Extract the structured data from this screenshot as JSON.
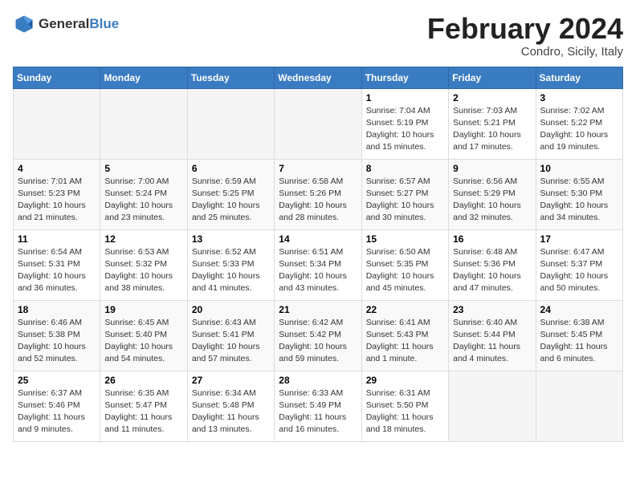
{
  "header": {
    "logo_general": "General",
    "logo_blue": "Blue",
    "month_title": "February 2024",
    "location": "Condro, Sicily, Italy"
  },
  "weekdays": [
    "Sunday",
    "Monday",
    "Tuesday",
    "Wednesday",
    "Thursday",
    "Friday",
    "Saturday"
  ],
  "weeks": [
    [
      {
        "day": "",
        "info": ""
      },
      {
        "day": "",
        "info": ""
      },
      {
        "day": "",
        "info": ""
      },
      {
        "day": "",
        "info": ""
      },
      {
        "day": "1",
        "info": "Sunrise: 7:04 AM\nSunset: 5:19 PM\nDaylight: 10 hours\nand 15 minutes."
      },
      {
        "day": "2",
        "info": "Sunrise: 7:03 AM\nSunset: 5:21 PM\nDaylight: 10 hours\nand 17 minutes."
      },
      {
        "day": "3",
        "info": "Sunrise: 7:02 AM\nSunset: 5:22 PM\nDaylight: 10 hours\nand 19 minutes."
      }
    ],
    [
      {
        "day": "4",
        "info": "Sunrise: 7:01 AM\nSunset: 5:23 PM\nDaylight: 10 hours\nand 21 minutes."
      },
      {
        "day": "5",
        "info": "Sunrise: 7:00 AM\nSunset: 5:24 PM\nDaylight: 10 hours\nand 23 minutes."
      },
      {
        "day": "6",
        "info": "Sunrise: 6:59 AM\nSunset: 5:25 PM\nDaylight: 10 hours\nand 25 minutes."
      },
      {
        "day": "7",
        "info": "Sunrise: 6:58 AM\nSunset: 5:26 PM\nDaylight: 10 hours\nand 28 minutes."
      },
      {
        "day": "8",
        "info": "Sunrise: 6:57 AM\nSunset: 5:27 PM\nDaylight: 10 hours\nand 30 minutes."
      },
      {
        "day": "9",
        "info": "Sunrise: 6:56 AM\nSunset: 5:29 PM\nDaylight: 10 hours\nand 32 minutes."
      },
      {
        "day": "10",
        "info": "Sunrise: 6:55 AM\nSunset: 5:30 PM\nDaylight: 10 hours\nand 34 minutes."
      }
    ],
    [
      {
        "day": "11",
        "info": "Sunrise: 6:54 AM\nSunset: 5:31 PM\nDaylight: 10 hours\nand 36 minutes."
      },
      {
        "day": "12",
        "info": "Sunrise: 6:53 AM\nSunset: 5:32 PM\nDaylight: 10 hours\nand 38 minutes."
      },
      {
        "day": "13",
        "info": "Sunrise: 6:52 AM\nSunset: 5:33 PM\nDaylight: 10 hours\nand 41 minutes."
      },
      {
        "day": "14",
        "info": "Sunrise: 6:51 AM\nSunset: 5:34 PM\nDaylight: 10 hours\nand 43 minutes."
      },
      {
        "day": "15",
        "info": "Sunrise: 6:50 AM\nSunset: 5:35 PM\nDaylight: 10 hours\nand 45 minutes."
      },
      {
        "day": "16",
        "info": "Sunrise: 6:48 AM\nSunset: 5:36 PM\nDaylight: 10 hours\nand 47 minutes."
      },
      {
        "day": "17",
        "info": "Sunrise: 6:47 AM\nSunset: 5:37 PM\nDaylight: 10 hours\nand 50 minutes."
      }
    ],
    [
      {
        "day": "18",
        "info": "Sunrise: 6:46 AM\nSunset: 5:38 PM\nDaylight: 10 hours\nand 52 minutes."
      },
      {
        "day": "19",
        "info": "Sunrise: 6:45 AM\nSunset: 5:40 PM\nDaylight: 10 hours\nand 54 minutes."
      },
      {
        "day": "20",
        "info": "Sunrise: 6:43 AM\nSunset: 5:41 PM\nDaylight: 10 hours\nand 57 minutes."
      },
      {
        "day": "21",
        "info": "Sunrise: 6:42 AM\nSunset: 5:42 PM\nDaylight: 10 hours\nand 59 minutes."
      },
      {
        "day": "22",
        "info": "Sunrise: 6:41 AM\nSunset: 5:43 PM\nDaylight: 11 hours\nand 1 minute."
      },
      {
        "day": "23",
        "info": "Sunrise: 6:40 AM\nSunset: 5:44 PM\nDaylight: 11 hours\nand 4 minutes."
      },
      {
        "day": "24",
        "info": "Sunrise: 6:38 AM\nSunset: 5:45 PM\nDaylight: 11 hours\nand 6 minutes."
      }
    ],
    [
      {
        "day": "25",
        "info": "Sunrise: 6:37 AM\nSunset: 5:46 PM\nDaylight: 11 hours\nand 9 minutes."
      },
      {
        "day": "26",
        "info": "Sunrise: 6:35 AM\nSunset: 5:47 PM\nDaylight: 11 hours\nand 11 minutes."
      },
      {
        "day": "27",
        "info": "Sunrise: 6:34 AM\nSunset: 5:48 PM\nDaylight: 11 hours\nand 13 minutes."
      },
      {
        "day": "28",
        "info": "Sunrise: 6:33 AM\nSunset: 5:49 PM\nDaylight: 11 hours\nand 16 minutes."
      },
      {
        "day": "29",
        "info": "Sunrise: 6:31 AM\nSunset: 5:50 PM\nDaylight: 11 hours\nand 18 minutes."
      },
      {
        "day": "",
        "info": ""
      },
      {
        "day": "",
        "info": ""
      }
    ]
  ]
}
